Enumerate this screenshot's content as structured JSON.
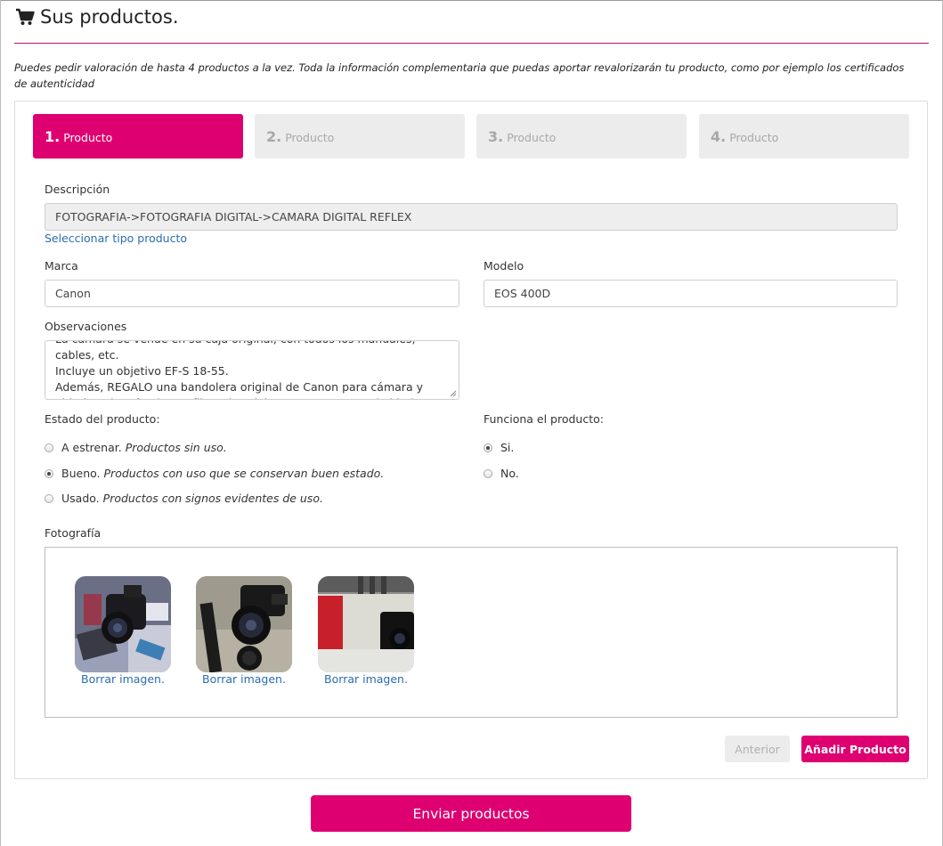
{
  "header": {
    "title": "Sus productos.",
    "cart_icon": "shopping-cart-icon",
    "intro": "Puedes pedir valoración de hasta 4 productos a la vez. Toda la información complementaria que puedas aportar revalorizarán tu producto, como por ejemplo los certificados de autenticidad"
  },
  "colors": {
    "accent": "#de0070",
    "rule": "#b0127e",
    "link": "#2a6db0",
    "inactive": "#ececec"
  },
  "steps": [
    {
      "num": "1.",
      "label": "Producto",
      "active": true
    },
    {
      "num": "2.",
      "label": "Producto",
      "active": false
    },
    {
      "num": "3.",
      "label": "Producto",
      "active": false
    },
    {
      "num": "4.",
      "label": "Producto",
      "active": false
    }
  ],
  "form": {
    "descripcion_label": "Descripción",
    "descripcion_value": "FOTOGRAFIA->FOTOGRAFIA DIGITAL->CAMARA DIGITAL REFLEX",
    "select_type_link": "Seleccionar tipo producto",
    "marca_label": "Marca",
    "marca_value": "Canon",
    "modelo_label": "Modelo",
    "modelo_value": "EOS 400D",
    "observaciones_label": "Observaciones",
    "observaciones_value": "La cámara se vende en su caja original, con todos los manuales, cables, etc.\nIncluye un objetivo EF-S 18-55.\nAdemás, REGALO una bandolera original de Canon para cámara y objetivos (ver foto) y un filtro ultravioleta para proteger el objetivo.",
    "estado_label": "Estado del producto:",
    "estado_options": [
      {
        "label": "A estrenar.",
        "desc": "Productos sin uso.",
        "checked": false
      },
      {
        "label": "Bueno.",
        "desc": "Productos con uso que se conservan buen estado.",
        "checked": true
      },
      {
        "label": "Usado.",
        "desc": "Productos con signos evidentes de uso.",
        "checked": false
      }
    ],
    "funciona_label": "Funciona el producto:",
    "funciona_options": [
      {
        "label": "Si.",
        "checked": true
      },
      {
        "label": "No.",
        "checked": false
      }
    ],
    "fotografia_label": "Fotografía",
    "photos": [
      {
        "delete_label": "Borrar imagen."
      },
      {
        "delete_label": "Borrar imagen."
      },
      {
        "delete_label": "Borrar imagen."
      }
    ]
  },
  "buttons": {
    "prev": "Anterior",
    "add": "Añadir Producto",
    "send": "Enviar productos"
  }
}
